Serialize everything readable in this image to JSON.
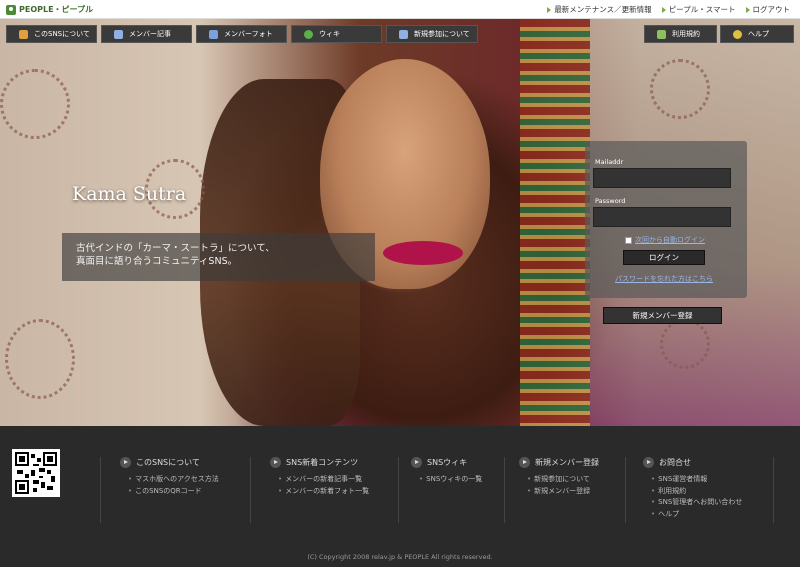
{
  "header": {
    "brand": "PEOPLE・ピープル",
    "links": [
      "最新メンテナンス／更新情報",
      "ピープル・スマート",
      "ログアウト"
    ]
  },
  "nav": {
    "left": [
      {
        "label": "このSNSについて",
        "icon": "people-icon",
        "color": "#e0a040"
      },
      {
        "label": "メンバー記事",
        "icon": "document-icon",
        "color": "#8fb0e0"
      },
      {
        "label": "メンバーフォト",
        "icon": "photo-icon",
        "color": "#7aa0e0"
      },
      {
        "label": "ウィキ",
        "icon": "globe-icon",
        "color": "#5ab04a"
      },
      {
        "label": "新規参加について",
        "icon": "user-icon",
        "color": "#8fb0e0"
      }
    ],
    "right": [
      {
        "label": "利用規約",
        "icon": "pencil-icon",
        "color": "#8fc060"
      },
      {
        "label": "ヘルプ",
        "icon": "help-icon",
        "color": "#e0c040"
      }
    ]
  },
  "hero": {
    "title": "Kama Sutra",
    "description_line1": "古代インドの「カーマ・スートラ」について、",
    "description_line2": "真面目に語り合うコミュニティSNS。"
  },
  "login": {
    "mail_label": "Mailaddr",
    "mail_value": "",
    "password_label": "Password",
    "password_value": "",
    "auto_login": "次回から自動ログイン",
    "login_button": "ログイン",
    "forgot": "パスワードを忘れた方はこちら",
    "register_button": "新規メンバー登録"
  },
  "footer": {
    "columns": [
      {
        "title": "このSNSについて",
        "links": [
          "マスホ版へのアクセス方法",
          "このSNSのQRコード"
        ]
      },
      {
        "title": "SNS新着コンテンツ",
        "links": [
          "メンバーの新着記事一覧",
          "メンバーの新着フォト一覧"
        ]
      },
      {
        "title": "SNSウィキ",
        "links": [
          "SNSウィキの一覧"
        ]
      },
      {
        "title": "新規メンバー登録",
        "links": [
          "新規参加について",
          "新規メンバー登録"
        ]
      },
      {
        "title": "お問合せ",
        "links": [
          "SNS運営者情報",
          "利用規約",
          "SNS管理者へお問い合わせ",
          "ヘルプ"
        ]
      }
    ],
    "copyright": "(C) Copyright 2008 relav.jp & PEOPLE All rights reserved."
  }
}
